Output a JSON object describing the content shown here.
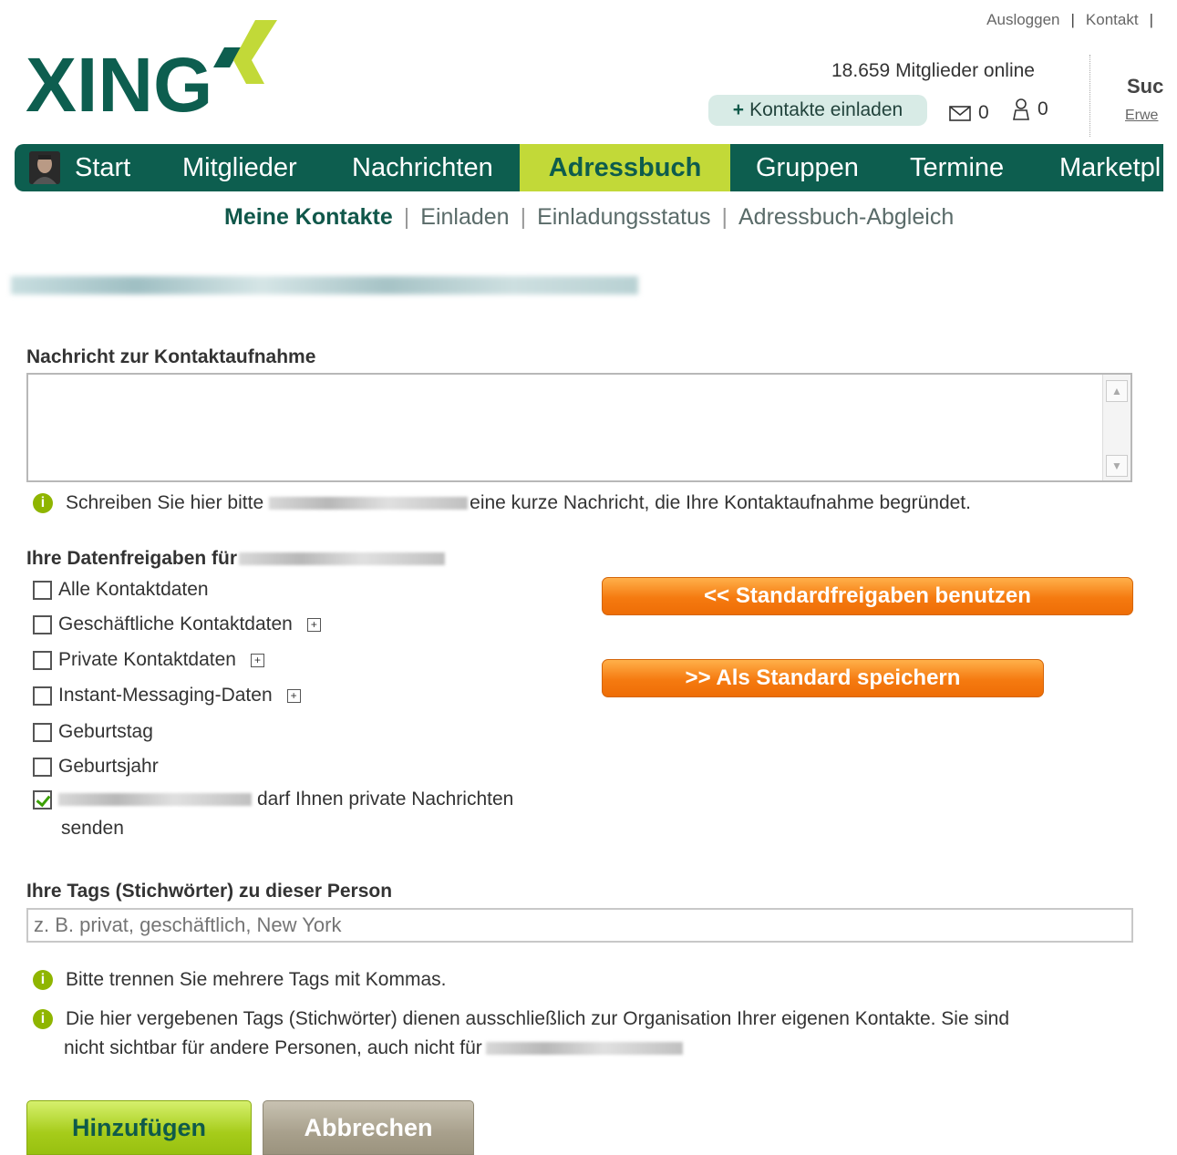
{
  "header": {
    "logout": "Ausloggen",
    "contact": "Kontakt",
    "logo_text": "XING",
    "members_online": "18.659 Mitglieder online",
    "invite_button": "Kontakte einladen",
    "messages_count": "0",
    "requests_count": "0",
    "search_label": "Suc",
    "extended_link": "Erwe"
  },
  "nav": {
    "items": [
      "Start",
      "Mitglieder",
      "Nachrichten",
      "Adressbuch",
      "Gruppen",
      "Termine",
      "Marketpl"
    ],
    "active": "Adressbuch"
  },
  "subnav": {
    "items": [
      "Meine Kontakte",
      "Einladen",
      "Einladungsstatus",
      "Adressbuch-Abgleich"
    ],
    "active": "Meine Kontakte"
  },
  "form": {
    "message_heading": "Nachricht zur Kontaktaufnahme",
    "message_value": "",
    "message_hint_before": "Schreiben Sie hier bitte",
    "message_hint_after": "eine kurze Nachricht, die Ihre Kontaktaufnahme begründet.",
    "sharing_heading": "Ihre Datenfreigaben für",
    "checkboxes": [
      {
        "label": "Alle Kontaktdaten",
        "checked": false
      },
      {
        "label": "Geschäftliche Kontaktdaten",
        "checked": false
      },
      {
        "label": "Private Kontaktdaten",
        "checked": false
      },
      {
        "label": "Instant-Messaging-Daten",
        "checked": false
      },
      {
        "label": "Geburtstag",
        "checked": false
      },
      {
        "label": "Geburtsjahr",
        "checked": false
      },
      {
        "label_line1": "darf Ihnen private Nachrichten",
        "label_line2": "senden",
        "checked": true
      }
    ],
    "use_defaults_button": "<< Standardfreigaben benutzen",
    "save_default_button": ">> Als Standard speichern",
    "tags_heading": "Ihre Tags (Stichwörter) zu dieser Person",
    "tags_placeholder": "z. B. privat, geschäftlich, New York",
    "tags_hint1": "Bitte trennen Sie mehrere Tags mit Kommas.",
    "tags_hint2_line1": "Die hier vergebenen Tags (Stichwörter) dienen ausschließlich zur Organisation Ihrer eigenen Kontakte. Sie sind",
    "tags_hint2_line2": "nicht sichtbar für andere Personen, auch nicht für",
    "add_button": "Hinzufügen",
    "cancel_button": "Abbrechen"
  },
  "colors": {
    "brand_green": "#0d5e4f",
    "accent_lime": "#c2d938",
    "orange": "#f57a10"
  }
}
